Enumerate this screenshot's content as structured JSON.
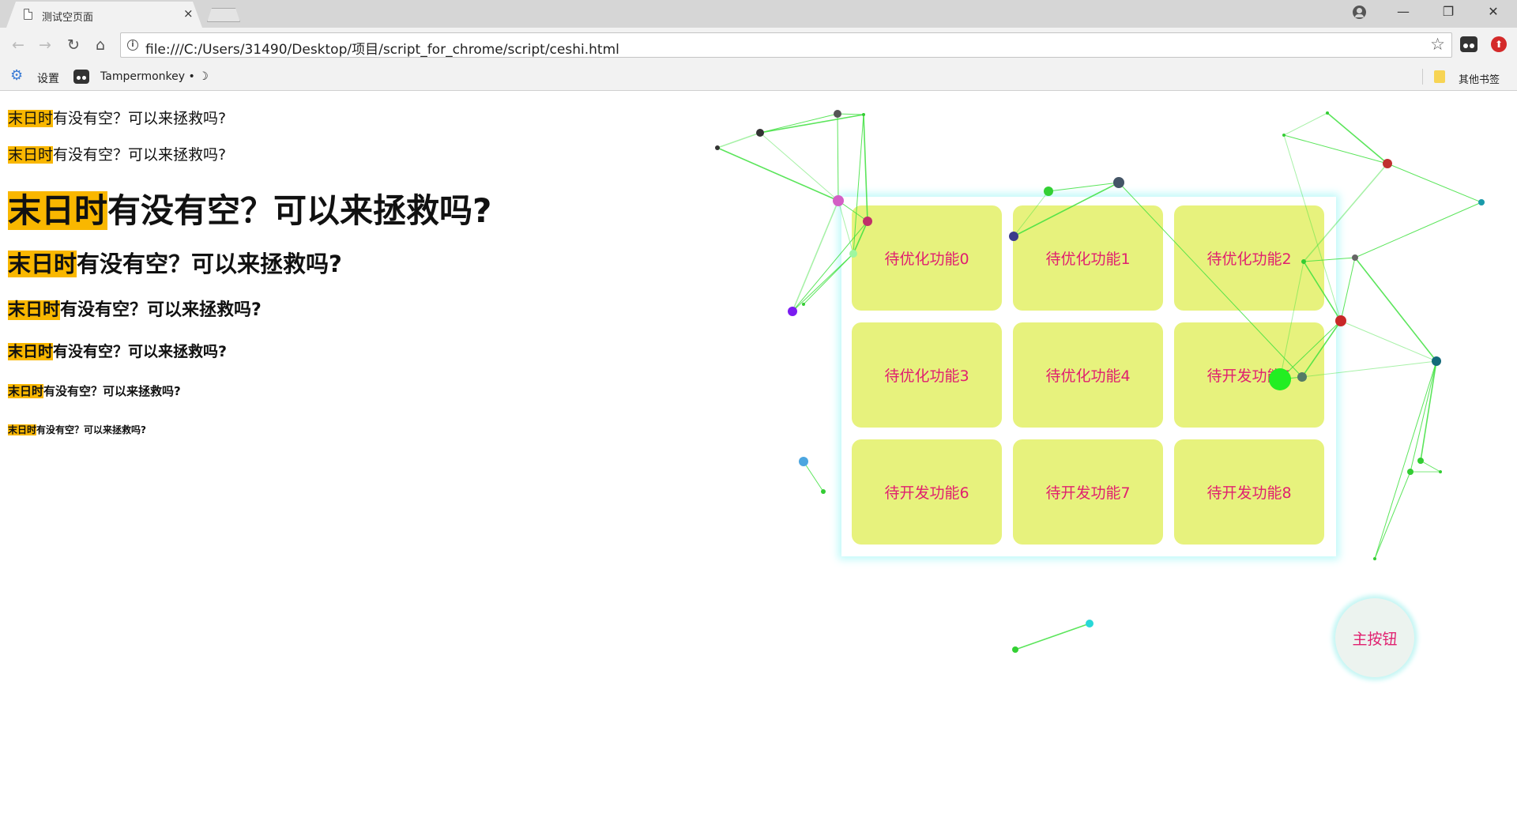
{
  "browser": {
    "tab_title": "测试空页面",
    "tab_close": "×",
    "url": "file:///C:/Users/31490/Desktop/项目/script_for_chrome/script/ceshi.html",
    "bookmarks": [
      {
        "label": "设置",
        "icon": "gear-icon"
      },
      {
        "label": "Tampermonkey • ☽",
        "icon": "tampermonkey-icon"
      }
    ],
    "other_bookmarks": "其他书签"
  },
  "content": {
    "highlight": "末日时",
    "rest": "有没有空？可以来拯救吗?",
    "rest_heading": "有没有空？可以来拯救吗?"
  },
  "panel": {
    "tiles": [
      "待优化功能0",
      "待优化功能1",
      "待优化功能2",
      "待优化功能3",
      "待优化功能4",
      "待开发功能5",
      "待开发功能6",
      "待开发功能7",
      "待开发功能8"
    ]
  },
  "main_button": "主按钮",
  "colors": {
    "highlight": "#f9b700",
    "tile_bg": "#e7f27d",
    "tile_text": "#e0206f",
    "net_line": "#3ee03e"
  }
}
